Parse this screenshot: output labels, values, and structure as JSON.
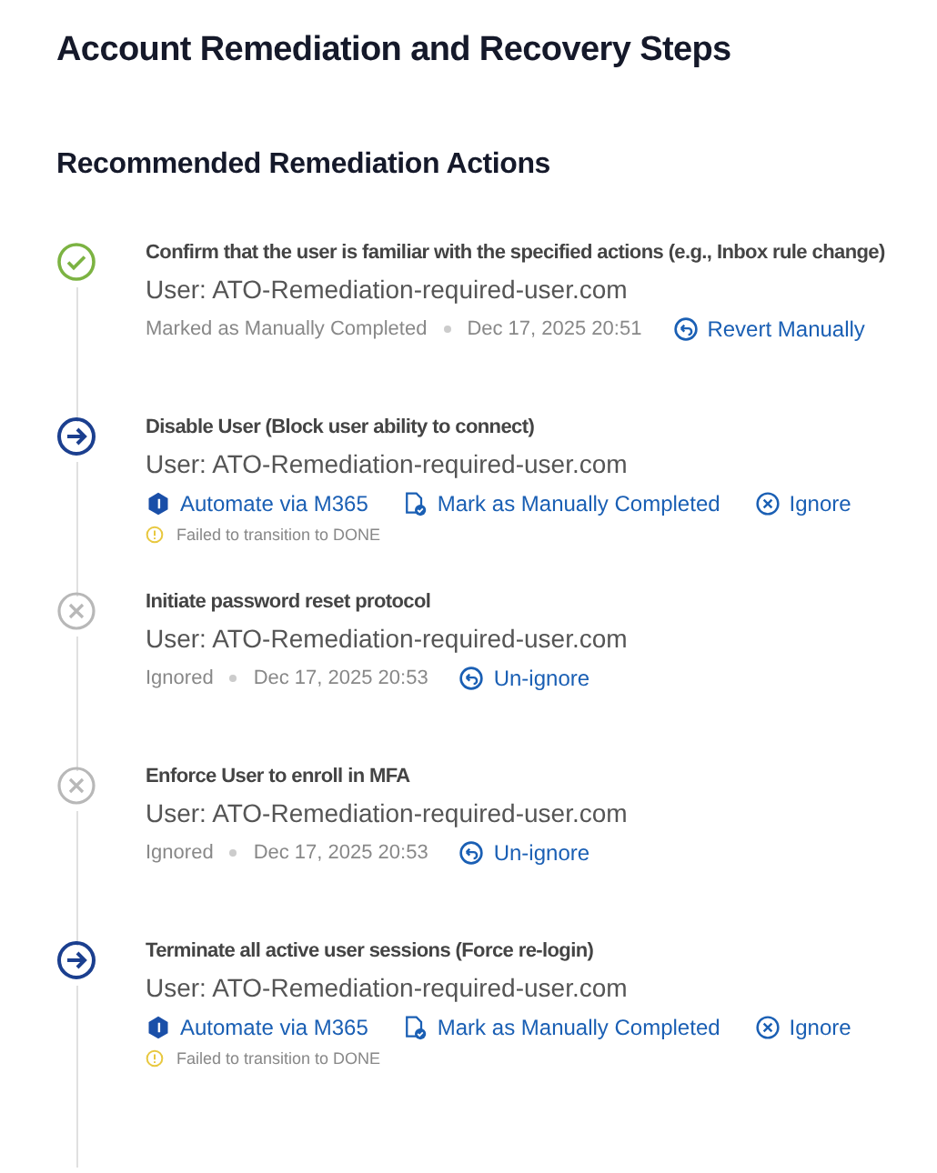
{
  "title": "Account Remediation and Recovery Steps",
  "section": {
    "heading": "Recommended Remediation Actions",
    "steps": [
      {
        "kind": "completed",
        "title": "Confirm that the user is familiar with the specified actions (e.g., Inbox rule change)",
        "user": "User: ATO-Remediation-required-user.com",
        "status": "Marked as Manually Completed",
        "date": "Dec 17, 2025 20:51",
        "revert": "Revert Manually"
      },
      {
        "kind": "pending",
        "title": "Disable User (Block user ability to connect)",
        "user": "User: ATO-Remediation-required-user.com",
        "actions": [
          {
            "kind": "automate",
            "label": "Automate via M365"
          },
          {
            "kind": "manual",
            "label": "Mark as Manually Completed"
          },
          {
            "kind": "ignore",
            "label": "Ignore"
          }
        ],
        "warning": "Failed to transition to DONE"
      },
      {
        "kind": "ignored",
        "title": "Initiate password reset protocol",
        "user": "User: ATO-Remediation-required-user.com",
        "status": "Ignored",
        "date": "Dec 17, 2025 20:53",
        "revert": "Un-ignore"
      },
      {
        "kind": "ignored",
        "title": "Enforce User to enroll in MFA",
        "user": "User: ATO-Remediation-required-user.com",
        "status": "Ignored",
        "date": "Dec 17, 2025 20:53",
        "revert": "Un-ignore"
      },
      {
        "kind": "pending",
        "title": "Terminate all active user sessions (Force re-login)",
        "user": "User: ATO-Remediation-required-user.com",
        "actions": [
          {
            "kind": "automate",
            "label": "Automate via M365"
          },
          {
            "kind": "manual",
            "label": "Mark as Manually Completed"
          },
          {
            "kind": "ignore",
            "label": "Ignore"
          }
        ],
        "warning": "Failed to transition to DONE"
      }
    ]
  }
}
